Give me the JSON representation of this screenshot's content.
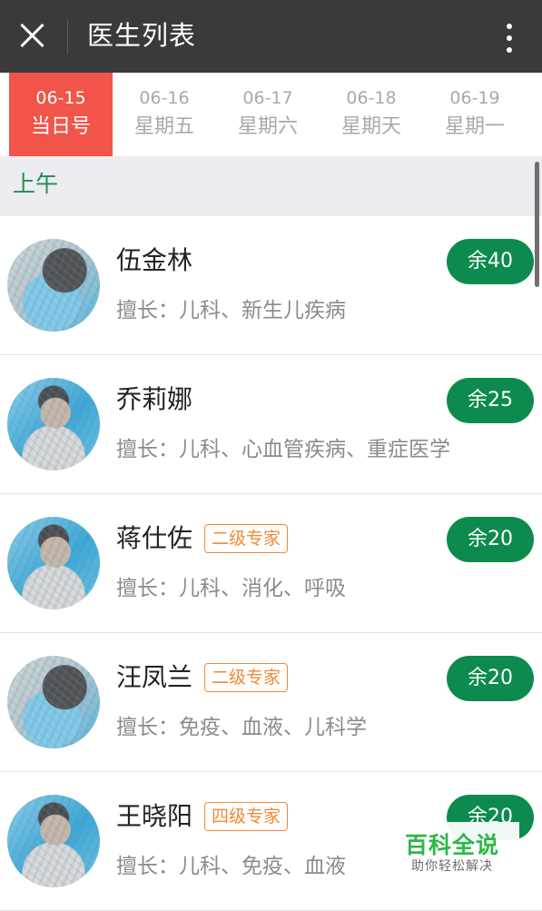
{
  "header": {
    "title": "医生列表",
    "close_icon": "close-icon",
    "more_icon": "more-vertical-icon",
    "background": "#3a3a3c"
  },
  "date_tabs": [
    {
      "date": "06-15",
      "day": "当日号",
      "active": true
    },
    {
      "date": "06-16",
      "day": "星期五",
      "active": false
    },
    {
      "date": "06-17",
      "day": "星期六",
      "active": false
    },
    {
      "date": "06-18",
      "day": "星期天",
      "active": false
    },
    {
      "date": "06-19",
      "day": "星期一",
      "active": false
    }
  ],
  "section": {
    "label": "上午"
  },
  "doctors": [
    {
      "name": "伍金林",
      "title": "",
      "specialty": "擅长：儿科、新生儿疾病",
      "slots": "余40",
      "avatar_icon": "doctor-avatar-icon"
    },
    {
      "name": "乔莉娜",
      "title": "",
      "specialty": "擅长：儿科、心血管疾病、重症医学",
      "slots": "余25",
      "avatar_icon": "doctor-avatar-icon"
    },
    {
      "name": "蒋仕佐",
      "title": "二级专家",
      "specialty": "擅长：儿科、消化、呼吸",
      "slots": "余20",
      "avatar_icon": "doctor-avatar-icon"
    },
    {
      "name": "汪凤兰",
      "title": "二级专家",
      "specialty": "擅长：免疫、血液、儿科学",
      "slots": "余20",
      "avatar_icon": "doctor-avatar-icon"
    },
    {
      "name": "王晓阳",
      "title": "四级专家",
      "specialty": "擅长：儿科、免疫、血液",
      "slots": "余20",
      "avatar_icon": "doctor-avatar-icon"
    }
  ],
  "watermark": {
    "title": "百科全说",
    "subtitle": "助你轻松解决"
  },
  "colors": {
    "accent": "#f25449",
    "section_text": "#1f8f55",
    "slot_button": "#0d8b4e",
    "badge": "#f08a36"
  }
}
